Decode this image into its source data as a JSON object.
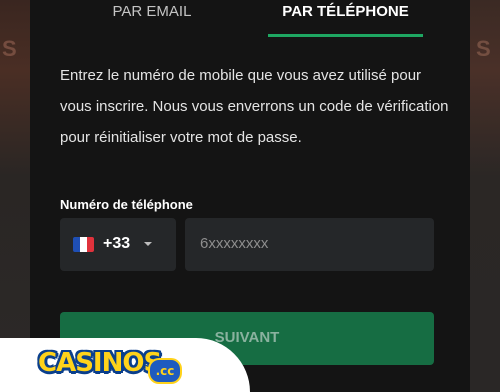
{
  "tabs": {
    "email_label": "PAR EMAIL",
    "phone_label": "PAR TÉLÉPHONE",
    "active": "phone"
  },
  "description": "Entrez le numéro de mobile que vous avez utilisé pour vous inscrire. Nous vous enverrons un code de vérification pour réinitialiser votre mot de passe.",
  "phone_field": {
    "label": "Numéro de téléphone",
    "country_flag": "france-flag",
    "dial_code": "+33",
    "placeholder": "6xxxxxxxx",
    "value": ""
  },
  "next_button": {
    "label": "SUIVANT",
    "state": "disabled"
  },
  "colors": {
    "accent": "#1ea762",
    "button": "#166d43",
    "modal_bg": "#141414",
    "field_bg": "#252729"
  },
  "icons": {
    "dropdown": "chevron-down-icon"
  },
  "watermark": {
    "text": "CASINOS",
    "suffix": ".cc"
  }
}
